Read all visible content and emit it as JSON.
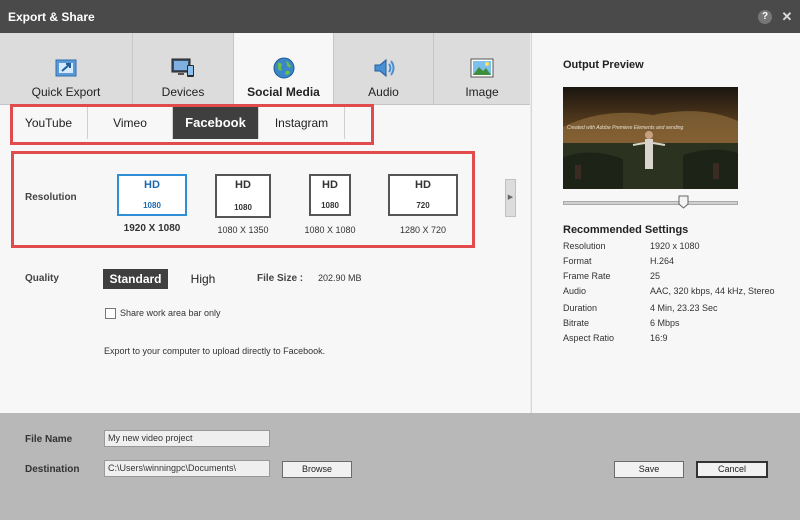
{
  "window": {
    "title": "Export & Share",
    "help_glyph": "?",
    "close_glyph": "✕"
  },
  "categories": [
    {
      "label": "Quick Export",
      "icon": "quick-export-icon"
    },
    {
      "label": "Devices",
      "icon": "devices-icon"
    },
    {
      "label": "Social Media",
      "icon": "globe-icon",
      "active": true
    },
    {
      "label": "Audio",
      "icon": "speaker-icon"
    },
    {
      "label": "Image",
      "icon": "picture-icon"
    }
  ],
  "subtabs": [
    {
      "label": "YouTube"
    },
    {
      "label": "Vimeo"
    },
    {
      "label": "Facebook",
      "active": true
    },
    {
      "label": "Instagram"
    }
  ],
  "resolution": {
    "label": "Resolution",
    "options": [
      {
        "badge": "HD",
        "number": "1080",
        "caption": "1920 X 1080",
        "selected": true
      },
      {
        "badge": "HD",
        "number": "1080",
        "caption": "1080 X 1350"
      },
      {
        "badge": "HD",
        "number": "1080",
        "caption": "1080 X 1080"
      },
      {
        "badge": "HD",
        "number": "720",
        "caption": "1280 X 720"
      }
    ]
  },
  "quality": {
    "label": "Quality",
    "standard": "Standard",
    "high": "High",
    "selected": "Standard"
  },
  "filesize": {
    "label": "File Size :",
    "value": "202.90 MB"
  },
  "work_area": {
    "label": "Share work area bar only",
    "checked": false
  },
  "info_text": "Export to your computer to upload directly to Facebook.",
  "preview": {
    "title": "Output Preview",
    "overlay_text": "Created with Adobe Premiere Elements and sending",
    "scrubber_position": 0.69
  },
  "recommended": {
    "title": "Recommended Settings",
    "rows": [
      {
        "key": "Resolution",
        "value": "1920 x 1080"
      },
      {
        "key": "Format",
        "value": "H.264"
      },
      {
        "key": "Frame Rate",
        "value": "25"
      },
      {
        "key": "Audio",
        "value": "AAC, 320 kbps, 44 kHz, Stereo"
      },
      {
        "key": "Duration",
        "value": "4 Min, 23.23 Sec"
      },
      {
        "key": "Bitrate",
        "value": "6 Mbps"
      },
      {
        "key": "Aspect Ratio",
        "value": "16:9"
      }
    ]
  },
  "footer": {
    "filename_label": "File Name",
    "filename_value": "My new video project",
    "destination_label": "Destination",
    "destination_value": "C:\\Users\\winningpc\\Documents\\",
    "browse": "Browse",
    "save": "Save",
    "cancel": "Cancel"
  },
  "colors": {
    "accent_selected": "#2f8fd6",
    "highlight_box": "#e24b4b",
    "titlebar": "#4a4a4a",
    "active_tab": "#3f3f3f"
  }
}
